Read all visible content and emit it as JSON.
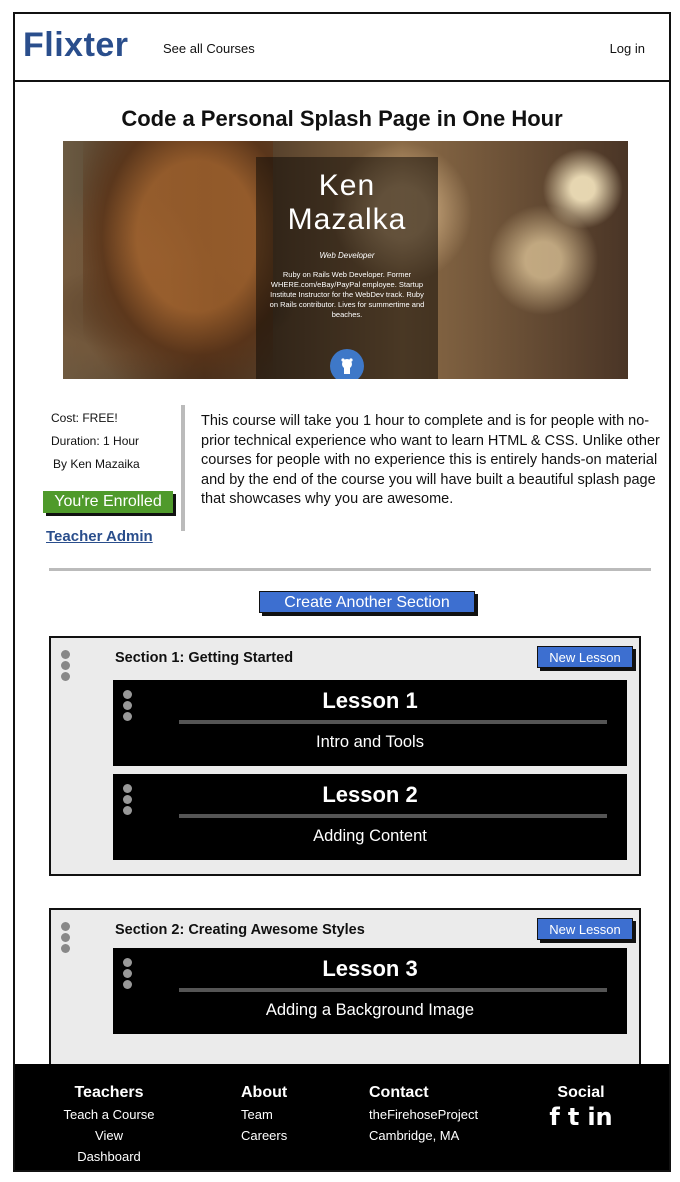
{
  "header": {
    "logo": "Flixter",
    "nav_courses": "See all Courses",
    "nav_login": "Log in"
  },
  "course": {
    "title": "Code a Personal Splash Page in One Hour",
    "hero": {
      "first_name": "Ken",
      "last_name": "Mazalka",
      "role": "Web Developer",
      "bio": "Ruby on Rails Web Developer. Former WHERE.com/eBay/PayPal employee. Startup Institute Instructor for the WebDev track. Ruby on Rails contributor. Lives for summertime and beaches."
    },
    "cost": "Cost: FREE!",
    "duration": "Duration: 1 Hour",
    "author": "By Ken Mazaika",
    "enrolled_label": "You're Enrolled",
    "teacher_admin_label": "Teacher Admin",
    "description": "This course will take you 1 hour to complete and is for people with no-prior technical experience who want to learn HTML & CSS. Unlike other courses for people with no experience this is entirely hands-on material and by the end of the course you will have built a beautiful splash page that showcases why you are awesome."
  },
  "create_section_label": "Create Another Section",
  "new_lesson_label": "New Lesson",
  "sections": [
    {
      "title": "Section 1: Getting Started",
      "lessons": [
        {
          "title": "Lesson 1",
          "subtitle": "Intro and Tools"
        },
        {
          "title": "Lesson 2",
          "subtitle": "Adding Content"
        }
      ]
    },
    {
      "title": "Section 2: Creating Awesome Styles",
      "lessons": [
        {
          "title": "Lesson 3",
          "subtitle": "Adding a Background Image"
        }
      ]
    }
  ],
  "footer": {
    "teachers": {
      "heading": "Teachers",
      "links": [
        "Teach a Course",
        "View Dashboard"
      ]
    },
    "about": {
      "heading": "About",
      "links": [
        "Team",
        "Careers"
      ]
    },
    "contact": {
      "heading": "Contact",
      "lines": [
        "theFirehoseProject",
        "Cambridge, MA"
      ]
    },
    "social": {
      "heading": "Social",
      "icons": [
        "facebook-icon",
        "twitter-icon",
        "linkedin-icon"
      ]
    }
  },
  "colors": {
    "brand": "#2a4e8c",
    "button_blue": "#3d6fd0",
    "enrolled_green": "#4f9a2b"
  }
}
